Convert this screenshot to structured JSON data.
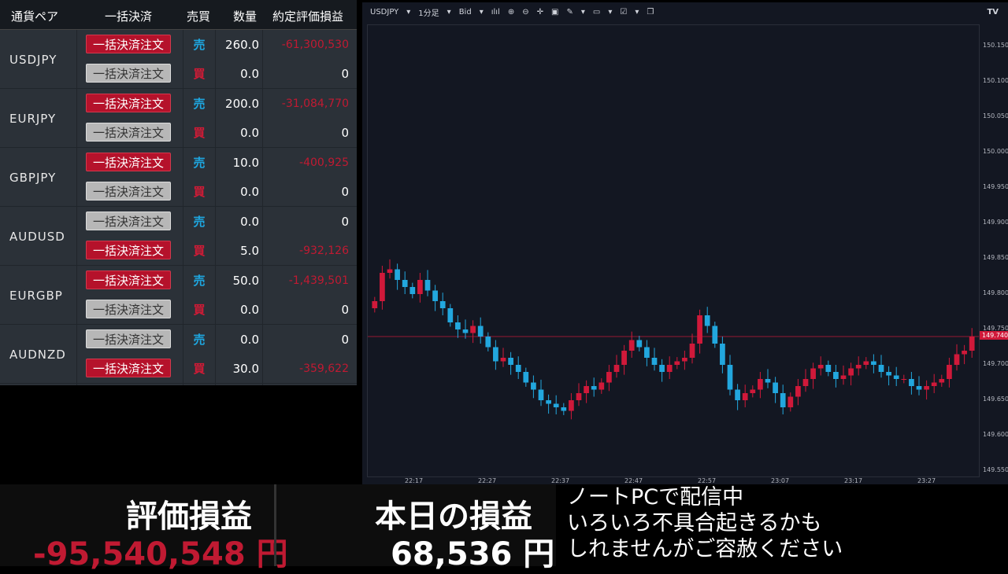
{
  "positions": {
    "headers": {
      "pair": "通貨ペア",
      "bulk": "一括決済",
      "side": "売買",
      "qty": "数量",
      "pl": "約定評価損益"
    },
    "groups": [
      {
        "pair": "USDJPY",
        "rows": [
          {
            "button": "一括決済注文",
            "active": true,
            "side": "売",
            "qty": "260.0",
            "pl": "-61,300,530"
          },
          {
            "button": "一括決済注文",
            "active": false,
            "side": "買",
            "qty": "0.0",
            "pl": "0"
          }
        ]
      },
      {
        "pair": "EURJPY",
        "rows": [
          {
            "button": "一括決済注文",
            "active": true,
            "side": "売",
            "qty": "200.0",
            "pl": "-31,084,770"
          },
          {
            "button": "一括決済注文",
            "active": false,
            "side": "買",
            "qty": "0.0",
            "pl": "0"
          }
        ]
      },
      {
        "pair": "GBPJPY",
        "rows": [
          {
            "button": "一括決済注文",
            "active": true,
            "side": "売",
            "qty": "10.0",
            "pl": "-400,925"
          },
          {
            "button": "一括決済注文",
            "active": false,
            "side": "買",
            "qty": "0.0",
            "pl": "0"
          }
        ]
      },
      {
        "pair": "AUDUSD",
        "rows": [
          {
            "button": "一括決済注文",
            "active": false,
            "side": "売",
            "qty": "0.0",
            "pl": "0"
          },
          {
            "button": "一括決済注文",
            "active": true,
            "side": "買",
            "qty": "5.0",
            "pl": "-932,126"
          }
        ]
      },
      {
        "pair": "EURGBP",
        "rows": [
          {
            "button": "一括決済注文",
            "active": true,
            "side": "売",
            "qty": "50.0",
            "pl": "-1,439,501"
          },
          {
            "button": "一括決済注文",
            "active": false,
            "side": "買",
            "qty": "0.0",
            "pl": "0"
          }
        ]
      },
      {
        "pair": "AUDNZD",
        "rows": [
          {
            "button": "一括決済注文",
            "active": false,
            "side": "売",
            "qty": "0.0",
            "pl": "0"
          },
          {
            "button": "一括決済注文",
            "active": true,
            "side": "買",
            "qty": "30.0",
            "pl": "-359,622"
          }
        ]
      }
    ]
  },
  "chart_toolbar": {
    "symbol": "USDJPY",
    "interval": "1分足",
    "price_type": "Bid",
    "logo": "TV"
  },
  "chart_data": {
    "type": "candlestick",
    "symbol": "USDJPY",
    "x_ticks": [
      "22:17",
      "22:27",
      "22:37",
      "22:47",
      "22:57",
      "23:07",
      "23:17",
      "23:27"
    ],
    "y_ticks": [
      "150.150",
      "150.100",
      "150.050",
      "150.000",
      "149.950",
      "149.900",
      "149.850",
      "149.800",
      "149.750",
      "149.700",
      "149.650",
      "149.600",
      "149.550"
    ],
    "ylim": [
      149.54,
      150.18
    ],
    "current_price": "149.740",
    "current_price_value": 149.74,
    "close_series": [
      149.79,
      149.83,
      149.835,
      149.82,
      149.81,
      149.8,
      149.82,
      149.805,
      149.79,
      149.78,
      149.76,
      149.75,
      149.745,
      149.755,
      149.74,
      149.725,
      149.705,
      149.71,
      149.7,
      149.69,
      149.675,
      149.665,
      149.65,
      149.645,
      149.64,
      149.635,
      149.65,
      149.66,
      149.67,
      149.665,
      149.675,
      149.69,
      149.7,
      149.72,
      149.735,
      149.725,
      149.71,
      149.7,
      149.69,
      149.7,
      149.705,
      149.71,
      149.73,
      149.77,
      149.755,
      149.73,
      149.7,
      149.665,
      149.65,
      149.66,
      149.665,
      149.68,
      149.675,
      149.66,
      149.64,
      149.655,
      149.67,
      149.68,
      149.695,
      149.7,
      149.69,
      149.68,
      149.685,
      149.695,
      149.7,
      149.705,
      149.7,
      149.69,
      149.685,
      149.68,
      149.68,
      149.67,
      149.665,
      149.67,
      149.675,
      149.68,
      149.7,
      149.715,
      149.72,
      149.74
    ]
  },
  "footer": {
    "unrealized_label": "評価損益",
    "unrealized_value": "-95,540,548 円",
    "today_label": "本日の損益",
    "today_value": "68,536 円"
  },
  "notice": {
    "lines": [
      "ノートPCで配信中",
      "いろいろ不具合起きるかも",
      "しれませんがご容赦ください"
    ]
  },
  "colors": {
    "up": "#d0193a",
    "down": "#22a7de",
    "negative": "#c01a32",
    "active_button": "#b5122b",
    "disabled_button": "#b7b7b7"
  }
}
